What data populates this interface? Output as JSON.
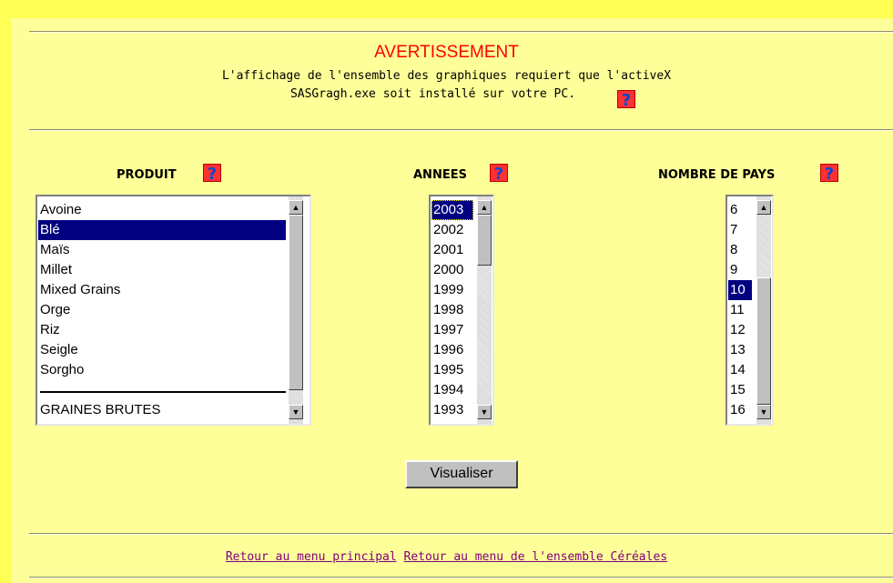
{
  "warning": {
    "title": "AVERTISSEMENT",
    "line1": "L'affichage de l'ensemble des graphiques requiert que l'activeX",
    "line2": "SASGragh.exe soit installé sur votre PC."
  },
  "help_glyph": "?",
  "produit": {
    "label": "PRODUIT",
    "items": [
      "Avoine",
      "Blé",
      "Maïs",
      "Millet",
      "Mixed Grains",
      "Orge",
      "Riz",
      "Seigle",
      "Sorgho"
    ],
    "last_item": "GRAINES BRUTES",
    "selected": "Blé"
  },
  "annees": {
    "label": "ANNEES",
    "items": [
      "2003",
      "2002",
      "2001",
      "2000",
      "1999",
      "1998",
      "1997",
      "1996",
      "1995",
      "1994",
      "1993"
    ],
    "selected": "2003"
  },
  "pays": {
    "label": "NOMBRE DE PAYS",
    "items": [
      "6",
      "7",
      "8",
      "9",
      "10",
      "11",
      "12",
      "13",
      "14",
      "15",
      "16"
    ],
    "selected": "10"
  },
  "visualize_label": "Visualiser",
  "footer": {
    "link_main": "Retour au menu principal",
    "link_cereals": "Retour au menu de l'ensemble Céréales"
  },
  "colors": {
    "page_background": "#ffff99",
    "frame_strip": "#ffff55",
    "warning_title": "#ff0000",
    "selection": "#000080",
    "link": "#800080"
  }
}
